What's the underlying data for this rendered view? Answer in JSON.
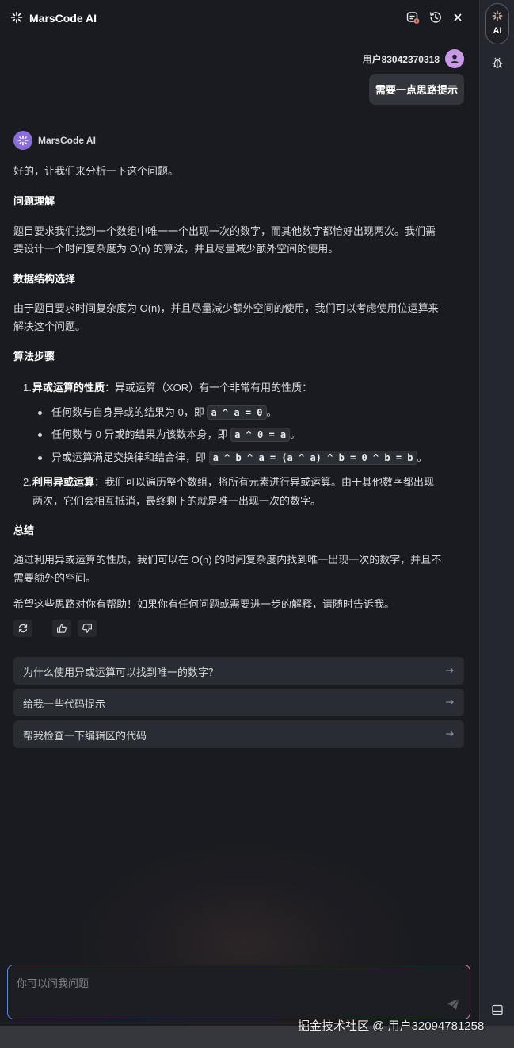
{
  "header": {
    "title": "MarsCode AI"
  },
  "user": {
    "name": "用户83042370318",
    "message": "需要一点思路提示"
  },
  "assistant": {
    "name": "MarsCode AI",
    "intro": "好的，让我们来分析一下这个问题。",
    "sec1_title": "问题理解",
    "sec1_line1": "题目要求我们找到一个数组中唯一一个出现一次的数字，而其他数字都恰好出现两次。我们需",
    "sec1_line2": "要设计一个时间复杂度为 O(n) 的算法，并且尽量减少额外空间的使用。",
    "sec2_title": "数据结构选择",
    "sec2_line1": "由于题目要求时间复杂度为 O(n)，并且尽量减少额外空间的使用，我们可以考虑使用位运算来",
    "sec2_line2": "解决这个问题。",
    "sec3_title": "算法步骤",
    "step1_num": "1.",
    "step1_bold": "异或运算的性质",
    "step1_text": "：异或运算（XOR）有一个非常有用的性质：",
    "bullet1_text": "任何数与自身异或的结果为 0，即",
    "bullet1_code": "a ^ a = 0",
    "bullet2_text": "任何数与 0 异或的结果为该数本身，即",
    "bullet2_code": "a ^ 0 = a",
    "bullet3_text": "异或运算满足交换律和结合律，即",
    "bullet3_code": "a ^ b ^ a = (a ^ a) ^ b = 0 ^ b = b",
    "period": "。",
    "step2_num": "2.",
    "step2_bold": "利用异或运算",
    "step2_line1": "：我们可以遍历整个数组，将所有元素进行异或运算。由于其他数字都出现",
    "step2_line2": "两次，它们会相互抵消，最终剩下的就是唯一出现一次的数字。",
    "sec4_title": "总结",
    "sum_line1": "通过利用异或运算的性质，我们可以在 O(n) 的时间复杂度内找到唯一出现一次的数字，并且不",
    "sum_line2": "需要额外的空间。",
    "closing": "希望这些思路对你有帮助！如果你有任何问题或需要进一步的解释，请随时告诉我。"
  },
  "suggestions": [
    {
      "label": "为什么使用异或运算可以找到唯一的数字？"
    },
    {
      "label": "给我一些代码提示"
    },
    {
      "label": "帮我检查一下编辑区的代码"
    }
  ],
  "input": {
    "placeholder": "你可以问我问题"
  },
  "rail": {
    "ai_label": "AI"
  },
  "watermark": "掘金技术社区 @ 用户32094781258",
  "icons": [
    "sparkle-icon",
    "new-chat-icon",
    "history-icon",
    "close-icon",
    "refresh-icon",
    "thumbs-up-icon",
    "thumbs-down-icon",
    "arrow-right-icon",
    "send-icon",
    "bug-icon",
    "layout-icon",
    "user-icon"
  ],
  "colors": {
    "background": "#1a1b20",
    "card": "#2a2c33",
    "user_avatar": "#c79ae6",
    "ai_avatar": "#8b6cd9",
    "accent_start": "#4a8cf0",
    "accent_end": "#e07ec0"
  }
}
